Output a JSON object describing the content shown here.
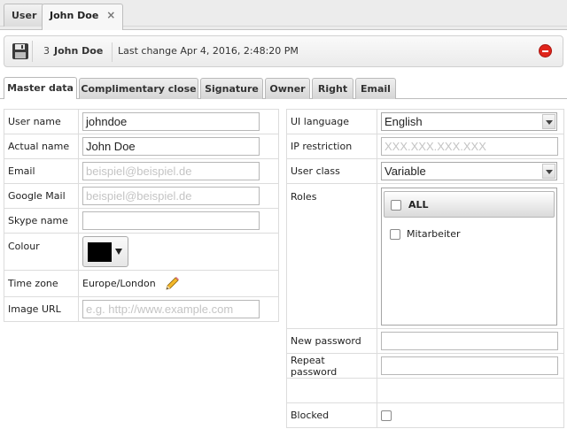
{
  "doc_tabs": [
    {
      "label": "User",
      "active": false
    },
    {
      "label": "John Doe",
      "active": true,
      "close": "×"
    }
  ],
  "toolbar": {
    "record_id": "3",
    "record_name": "John Doe",
    "last_change": "Last change Apr 4, 2016, 2:48:20 PM",
    "close_color": "#e0241b"
  },
  "section_tabs": [
    {
      "label": "Master data",
      "active": true
    },
    {
      "label": "Complimentary close",
      "active": false
    },
    {
      "label": "Signature",
      "active": false
    },
    {
      "label": "Owner",
      "active": false
    },
    {
      "label": "Right",
      "active": false
    },
    {
      "label": "Email",
      "active": false
    }
  ],
  "left_form": {
    "user_name": {
      "label": "User name",
      "value": "johndoe"
    },
    "actual_name": {
      "label": "Actual name",
      "value": "John Doe"
    },
    "email": {
      "label": "Email",
      "placeholder": "beispiel@beispiel.de"
    },
    "google_mail": {
      "label": "Google Mail",
      "placeholder": "beispiel@beispiel.de"
    },
    "skype_name": {
      "label": "Skype name",
      "value": ""
    },
    "colour": {
      "label": "Colour",
      "value": "#000000"
    },
    "time_zone": {
      "label": "Time zone",
      "value": "Europe/London"
    },
    "image_url": {
      "label": "Image URL",
      "placeholder": "e.g. http://www.example.com"
    }
  },
  "right_form": {
    "ui_language": {
      "label": "UI language",
      "value": "English"
    },
    "ip_restriction": {
      "label": "IP restriction",
      "placeholder": "XXX.XXX.XXX.XXX"
    },
    "user_class": {
      "label": "User class",
      "value": "Variable"
    },
    "roles": {
      "label": "Roles",
      "items": [
        {
          "label": "ALL",
          "checked": false
        },
        {
          "label": "Mitarbeiter",
          "checked": false
        }
      ]
    },
    "new_password": {
      "label": "New password",
      "value": ""
    },
    "repeat_password": {
      "label": "Repeat password",
      "value": ""
    },
    "blocked": {
      "label": "Blocked",
      "checked": false
    }
  }
}
